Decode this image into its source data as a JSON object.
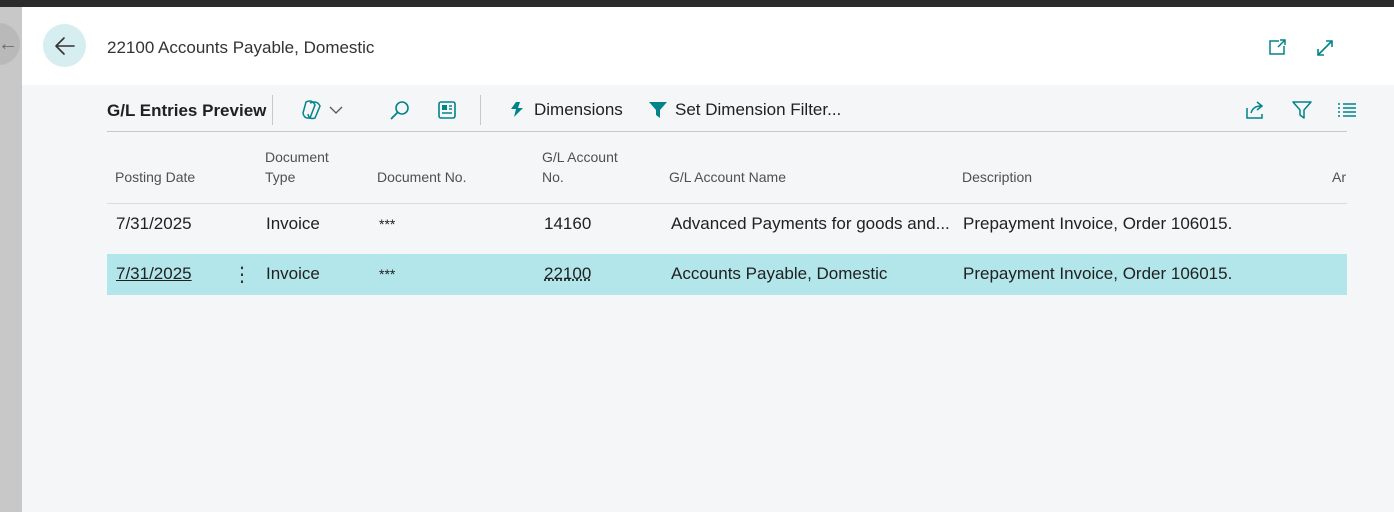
{
  "header": {
    "title": "22100 Accounts Payable, Domestic",
    "back_icon": "arrow-left-icon",
    "popout_icon": "open-new-window-icon",
    "expand_icon": "expand-icon"
  },
  "toolbar": {
    "title": "G/L Entries Preview",
    "actions": [
      {
        "label": "Dimensions",
        "icon": "dimensions-icon"
      },
      {
        "label": "Set Dimension Filter...",
        "icon": "filter-funnel-icon"
      }
    ],
    "icons": [
      "copilot-icon",
      "chevron-down-icon",
      "search-icon",
      "edit-list-icon",
      "share-icon",
      "filter-icon",
      "list-view-icon"
    ]
  },
  "table": {
    "columns": [
      {
        "line1": "",
        "line2": "Posting Date"
      },
      {
        "line1": "Document",
        "line2": "Type"
      },
      {
        "line1": "",
        "line2": "Document No."
      },
      {
        "line1": "G/L Account",
        "line2": "No."
      },
      {
        "line1": "",
        "line2": "G/L Account Name"
      },
      {
        "line1": "",
        "line2": "Description"
      },
      {
        "line1": "",
        "line2": "Ar"
      }
    ],
    "rows": [
      {
        "posting_date": "7/31/2025",
        "doc_type": "Invoice",
        "doc_no": "***",
        "account_no": "14160",
        "account_name": "Advanced Payments for goods and...",
        "description": "Prepayment Invoice, Order 106015.",
        "selected": false
      },
      {
        "posting_date": "7/31/2025",
        "doc_type": "Invoice",
        "doc_no": "***",
        "account_no": "22100",
        "account_name": "Accounts Payable, Domestic",
        "description": "Prepayment Invoice, Order 106015.",
        "selected": true
      }
    ],
    "row_menu_glyph": "⋮"
  },
  "colors": {
    "accent": "#00848a",
    "selected_row": "#b2e6ea",
    "back_button": "#d6eef0"
  }
}
